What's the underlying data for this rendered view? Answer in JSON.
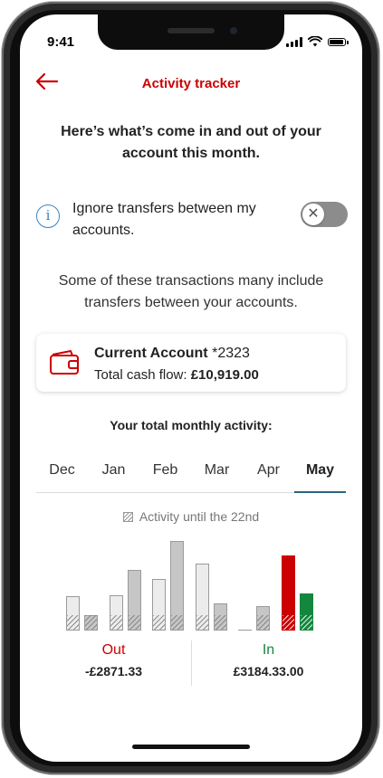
{
  "status_bar": {
    "time": "9:41"
  },
  "header": {
    "title": "Activity tracker"
  },
  "intro": "Here’s what’s come in and out of your account this month.",
  "ignore_transfers": {
    "label": "Ignore transfers between my accounts.",
    "enabled": false
  },
  "note": "Some of these transactions many include transfers between your accounts.",
  "account": {
    "name": "Current Account",
    "number": "*2323",
    "cash_flow_label": "Total cash flow:",
    "cash_flow_value": "£10,919.00"
  },
  "monthly": {
    "heading": "Your total monthly activity:",
    "tabs": [
      "Dec",
      "Jan",
      "Feb",
      "Mar",
      "Apr",
      "May"
    ],
    "selected_tab": "May",
    "legend_note": "Activity until the 22nd"
  },
  "chart_data": {
    "type": "bar",
    "categories": [
      "Dec",
      "Jan",
      "Feb",
      "Mar",
      "Apr",
      "May"
    ],
    "series": [
      {
        "name": "Out",
        "values": [
          36,
          37,
          54,
          70,
          0,
          78
        ]
      },
      {
        "name": "In",
        "values": [
          16,
          63,
          93,
          28,
          25,
          39
        ]
      }
    ],
    "highlight_category": "May",
    "colors": {
      "out_current": "#cc0000",
      "in_current": "#14873f",
      "out": "#ececec",
      "in": "#c6c6c6"
    }
  },
  "totals": {
    "out_label": "Out",
    "out_value": "-£2871.33",
    "in_label": "In",
    "in_value": "£3184.33.00"
  },
  "colors": {
    "brand": "#cc0000",
    "info": "#3a84c4",
    "positive": "#14873f",
    "tab_underline": "#2b6283"
  },
  "icons": {
    "back": "arrow-left-icon",
    "info": "info-icon",
    "toggle": "close-icon",
    "account": "wallet-icon",
    "legend": "hatched-swatch-icon"
  }
}
